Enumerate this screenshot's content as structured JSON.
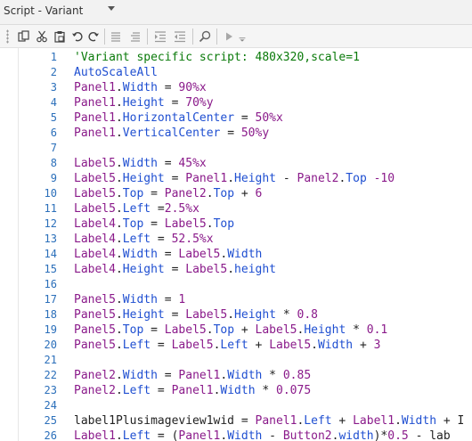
{
  "window": {
    "title": "Script - Variant"
  },
  "toolbar": {
    "buttons": [
      {
        "name": "copy-icon"
      },
      {
        "name": "cut-icon"
      },
      {
        "name": "paste-icon"
      },
      {
        "name": "undo-icon"
      },
      {
        "name": "redo-icon"
      },
      {
        "name": "comment-icon"
      },
      {
        "name": "uncomment-icon"
      },
      {
        "name": "indent-icon"
      },
      {
        "name": "outdent-icon"
      },
      {
        "name": "search-icon"
      },
      {
        "name": "run-icon"
      },
      {
        "name": "overflow-chevron-icon"
      }
    ]
  },
  "editor": {
    "lines": [
      {
        "n": "1",
        "tokens": [
          [
            "'Variant specific script: 480x320,scale=1",
            "comment"
          ]
        ]
      },
      {
        "n": "2",
        "tokens": [
          [
            "AutoScaleAll",
            "kw"
          ]
        ]
      },
      {
        "n": "3",
        "tokens": [
          [
            "Panel1",
            "obj"
          ],
          [
            ".",
            "op"
          ],
          [
            "Width",
            "prop"
          ],
          [
            " = ",
            "op"
          ],
          [
            "90%x",
            "num"
          ]
        ]
      },
      {
        "n": "4",
        "tokens": [
          [
            "Panel1",
            "obj"
          ],
          [
            ".",
            "op"
          ],
          [
            "Height",
            "prop"
          ],
          [
            " = ",
            "op"
          ],
          [
            "70%y",
            "num"
          ]
        ]
      },
      {
        "n": "5",
        "tokens": [
          [
            "Panel1",
            "obj"
          ],
          [
            ".",
            "op"
          ],
          [
            "HorizontalCenter",
            "prop"
          ],
          [
            " = ",
            "op"
          ],
          [
            "50%x",
            "num"
          ]
        ]
      },
      {
        "n": "6",
        "tokens": [
          [
            "Panel1",
            "obj"
          ],
          [
            ".",
            "op"
          ],
          [
            "VerticalCenter",
            "prop"
          ],
          [
            " = ",
            "op"
          ],
          [
            "50%y",
            "num"
          ]
        ]
      },
      {
        "n": "7",
        "tokens": []
      },
      {
        "n": "8",
        "tokens": [
          [
            "Label5",
            "obj"
          ],
          [
            ".",
            "op"
          ],
          [
            "Width",
            "prop"
          ],
          [
            " = ",
            "op"
          ],
          [
            "45%x",
            "num"
          ]
        ]
      },
      {
        "n": "9",
        "tokens": [
          [
            "Label5",
            "obj"
          ],
          [
            ".",
            "op"
          ],
          [
            "Height",
            "prop"
          ],
          [
            " = ",
            "op"
          ],
          [
            "Panel1",
            "obj"
          ],
          [
            ".",
            "op"
          ],
          [
            "Height",
            "prop"
          ],
          [
            " - ",
            "op"
          ],
          [
            "Panel2",
            "obj"
          ],
          [
            ".",
            "op"
          ],
          [
            "Top",
            "prop"
          ],
          [
            " -10",
            "num"
          ]
        ]
      },
      {
        "n": "10",
        "tokens": [
          [
            "Label5",
            "obj"
          ],
          [
            ".",
            "op"
          ],
          [
            "Top",
            "prop"
          ],
          [
            " = ",
            "op"
          ],
          [
            "Panel2",
            "obj"
          ],
          [
            ".",
            "op"
          ],
          [
            "Top",
            "prop"
          ],
          [
            " + ",
            "op"
          ],
          [
            "6",
            "num"
          ]
        ]
      },
      {
        "n": "11",
        "tokens": [
          [
            "Label5",
            "obj"
          ],
          [
            ".",
            "op"
          ],
          [
            "Left",
            "prop"
          ],
          [
            " =",
            "op"
          ],
          [
            "2.5%x",
            "num"
          ]
        ]
      },
      {
        "n": "12",
        "tokens": [
          [
            "Label4",
            "obj"
          ],
          [
            ".",
            "op"
          ],
          [
            "Top",
            "prop"
          ],
          [
            " = ",
            "op"
          ],
          [
            "Label5",
            "obj"
          ],
          [
            ".",
            "op"
          ],
          [
            "Top",
            "prop"
          ]
        ]
      },
      {
        "n": "13",
        "tokens": [
          [
            "Label4",
            "obj"
          ],
          [
            ".",
            "op"
          ],
          [
            "Left",
            "prop"
          ],
          [
            " = ",
            "op"
          ],
          [
            "52.5%x",
            "num"
          ]
        ]
      },
      {
        "n": "14",
        "tokens": [
          [
            "Label4",
            "obj"
          ],
          [
            ".",
            "op"
          ],
          [
            "Width",
            "prop"
          ],
          [
            " = ",
            "op"
          ],
          [
            "Label5",
            "obj"
          ],
          [
            ".",
            "op"
          ],
          [
            "Width",
            "prop"
          ]
        ]
      },
      {
        "n": "15",
        "tokens": [
          [
            "Label4",
            "obj"
          ],
          [
            ".",
            "op"
          ],
          [
            "Height",
            "prop"
          ],
          [
            " = ",
            "op"
          ],
          [
            "Label5",
            "obj"
          ],
          [
            ".",
            "op"
          ],
          [
            "height",
            "prop"
          ]
        ]
      },
      {
        "n": "16",
        "tokens": []
      },
      {
        "n": "17",
        "tokens": [
          [
            "Panel5",
            "obj"
          ],
          [
            ".",
            "op"
          ],
          [
            "Width",
            "prop"
          ],
          [
            " = ",
            "op"
          ],
          [
            "1",
            "num"
          ]
        ]
      },
      {
        "n": "18",
        "tokens": [
          [
            "Panel5",
            "obj"
          ],
          [
            ".",
            "op"
          ],
          [
            "Height",
            "prop"
          ],
          [
            " = ",
            "op"
          ],
          [
            "Label5",
            "obj"
          ],
          [
            ".",
            "op"
          ],
          [
            "Height",
            "prop"
          ],
          [
            " * ",
            "op"
          ],
          [
            "0.8",
            "num"
          ]
        ]
      },
      {
        "n": "19",
        "tokens": [
          [
            "Panel5",
            "obj"
          ],
          [
            ".",
            "op"
          ],
          [
            "Top",
            "prop"
          ],
          [
            " = ",
            "op"
          ],
          [
            "Label5",
            "obj"
          ],
          [
            ".",
            "op"
          ],
          [
            "Top",
            "prop"
          ],
          [
            " + ",
            "op"
          ],
          [
            "Label5",
            "obj"
          ],
          [
            ".",
            "op"
          ],
          [
            "Height",
            "prop"
          ],
          [
            " * ",
            "op"
          ],
          [
            "0.1",
            "num"
          ]
        ]
      },
      {
        "n": "20",
        "tokens": [
          [
            "Panel5",
            "obj"
          ],
          [
            ".",
            "op"
          ],
          [
            "Left",
            "prop"
          ],
          [
            " = ",
            "op"
          ],
          [
            "Label5",
            "obj"
          ],
          [
            ".",
            "op"
          ],
          [
            "Left",
            "prop"
          ],
          [
            " + ",
            "op"
          ],
          [
            "Label5",
            "obj"
          ],
          [
            ".",
            "op"
          ],
          [
            "Width",
            "prop"
          ],
          [
            " + ",
            "op"
          ],
          [
            "3",
            "num"
          ]
        ]
      },
      {
        "n": "21",
        "tokens": []
      },
      {
        "n": "22",
        "tokens": [
          [
            "Panel2",
            "obj"
          ],
          [
            ".",
            "op"
          ],
          [
            "Width",
            "prop"
          ],
          [
            " = ",
            "op"
          ],
          [
            "Panel1",
            "obj"
          ],
          [
            ".",
            "op"
          ],
          [
            "Width",
            "prop"
          ],
          [
            " * ",
            "op"
          ],
          [
            "0.85",
            "num"
          ]
        ]
      },
      {
        "n": "23",
        "tokens": [
          [
            "Panel2",
            "obj"
          ],
          [
            ".",
            "op"
          ],
          [
            "Left",
            "prop"
          ],
          [
            " = ",
            "op"
          ],
          [
            "Panel1",
            "obj"
          ],
          [
            ".",
            "op"
          ],
          [
            "Width",
            "prop"
          ],
          [
            " * ",
            "op"
          ],
          [
            "0.075",
            "num"
          ]
        ]
      },
      {
        "n": "24",
        "tokens": []
      },
      {
        "n": "25",
        "tokens": [
          [
            "label1Plusimageview1wid",
            "plain"
          ],
          [
            " = ",
            "op"
          ],
          [
            "Panel1",
            "obj"
          ],
          [
            ".",
            "op"
          ],
          [
            "Left",
            "prop"
          ],
          [
            " + ",
            "op"
          ],
          [
            "Label1",
            "obj"
          ],
          [
            ".",
            "op"
          ],
          [
            "Width",
            "prop"
          ],
          [
            " + ",
            "op"
          ],
          [
            "I",
            "plain"
          ]
        ]
      },
      {
        "n": "26",
        "tokens": [
          [
            "Label1",
            "obj"
          ],
          [
            ".",
            "op"
          ],
          [
            "Left",
            "prop"
          ],
          [
            " = ",
            "op"
          ],
          [
            "(",
            "op"
          ],
          [
            "Panel1",
            "obj"
          ],
          [
            ".",
            "op"
          ],
          [
            "Width",
            "prop"
          ],
          [
            " - ",
            "op"
          ],
          [
            "Button2",
            "obj"
          ],
          [
            ".",
            "op"
          ],
          [
            "width",
            "prop"
          ],
          [
            ")*",
            "op"
          ],
          [
            "0.5",
            "num"
          ],
          [
            " - ",
            "op"
          ],
          [
            "lab",
            "plain"
          ]
        ]
      }
    ]
  }
}
